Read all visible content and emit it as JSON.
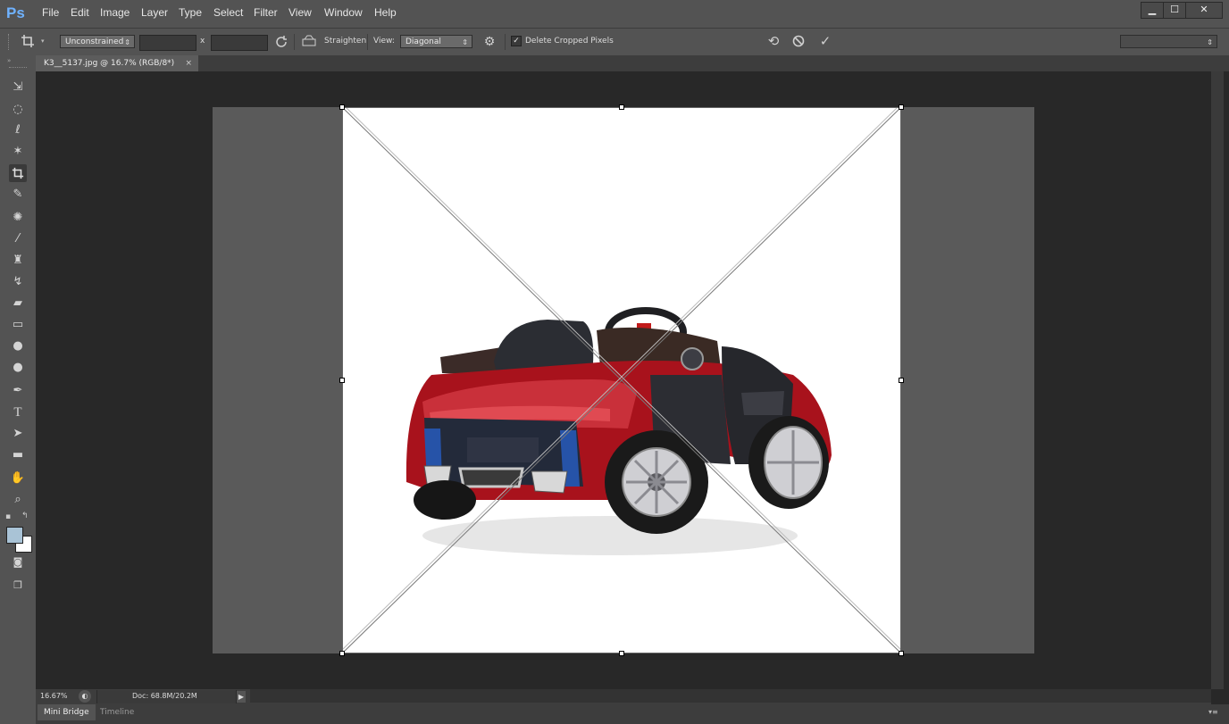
{
  "app": {
    "logo": "Ps"
  },
  "menu": [
    "File",
    "Edit",
    "Image",
    "Layer",
    "Type",
    "Select",
    "Filter",
    "View",
    "Window",
    "Help"
  ],
  "window_controls": {
    "minimize": "▁",
    "maximize": "☐",
    "close": "✕"
  },
  "options": {
    "ratio_label": "Unconstrained",
    "width_value": "",
    "height_value": "",
    "x_sep": "x",
    "straighten_label": "Straighten",
    "view_label": "View:",
    "view_value": "Diagonal",
    "delete_cropped_label": "Delete Cropped Pixels",
    "delete_cropped_checked": true,
    "workspace_select": ""
  },
  "document": {
    "tab_title": "K3__5137.jpg @ 16.7% (RGB/8*)",
    "close_glyph": "×"
  },
  "status": {
    "zoom": "16.67%",
    "doc_size": "Doc: 68.8M/20.2M"
  },
  "bottom_tabs": [
    "Mini Bridge",
    "Timeline"
  ],
  "colors": {
    "foreground": "#a9c3d6",
    "background": "#ffffff",
    "accent": "#6fb2ff",
    "car_red": "#b0101c"
  },
  "tools": [
    "move-tool",
    "marquee-tool",
    "lasso-tool",
    "magic-wand-tool",
    "crop-tool",
    "eyedropper-tool",
    "spot-healing-tool",
    "brush-tool",
    "clone-stamp-tool",
    "history-brush-tool",
    "eraser-tool",
    "gradient-tool",
    "blur-tool",
    "dodge-tool",
    "pen-tool",
    "type-tool",
    "path-selection-tool",
    "rectangle-tool",
    "hand-tool",
    "zoom-tool"
  ]
}
